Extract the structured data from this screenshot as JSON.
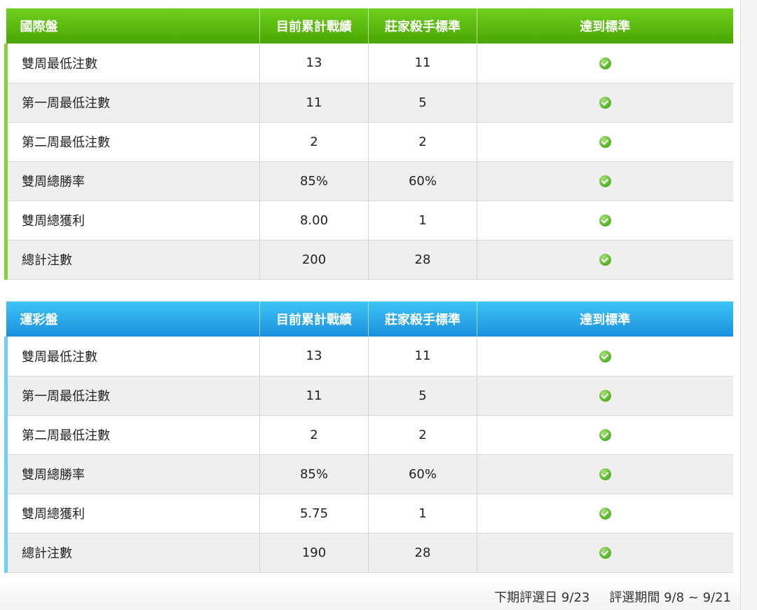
{
  "tables": [
    {
      "title": "國際盤",
      "headers": [
        "目前累計戰績",
        "莊家殺手標準",
        "達到標準"
      ],
      "rows": [
        {
          "label": "雙周最低注數",
          "current": "13",
          "standard": "11",
          "achieved": "check-icon"
        },
        {
          "label": "第一周最低注數",
          "current": "11",
          "standard": "5",
          "achieved": "check-icon"
        },
        {
          "label": "第二周最低注數",
          "current": "2",
          "standard": "2",
          "achieved": "check-icon"
        },
        {
          "label": "雙周總勝率",
          "current": "85%",
          "standard": "60%",
          "achieved": "check-icon"
        },
        {
          "label": "雙周總獲利",
          "current": "8.00",
          "standard": "1",
          "achieved": "check-icon"
        },
        {
          "label": "總計注數",
          "current": "200",
          "standard": "28",
          "achieved": "check-icon"
        }
      ],
      "colors": {
        "header_top": "#6fd020",
        "header_bottom": "#4aa600",
        "accent": "#84d33a"
      }
    },
    {
      "title": "運彩盤",
      "headers": [
        "目前累計戰績",
        "莊家殺手標準",
        "達到標準"
      ],
      "rows": [
        {
          "label": "雙周最低注數",
          "current": "13",
          "standard": "11",
          "achieved": "check-icon"
        },
        {
          "label": "第一周最低注數",
          "current": "11",
          "standard": "5",
          "achieved": "check-icon"
        },
        {
          "label": "第二周最低注數",
          "current": "2",
          "standard": "2",
          "achieved": "check-icon"
        },
        {
          "label": "雙周總勝率",
          "current": "85%",
          "standard": "60%",
          "achieved": "check-icon"
        },
        {
          "label": "雙周總獲利",
          "current": "5.75",
          "standard": "1",
          "achieved": "check-icon"
        },
        {
          "label": "總計注數",
          "current": "190",
          "standard": "28",
          "achieved": "check-icon"
        }
      ],
      "colors": {
        "header_top": "#3ec4f7",
        "header_bottom": "#1a8fdd",
        "accent": "#6fd0ef"
      }
    }
  ],
  "footer": {
    "next_selection": "下期評選日 9/23",
    "selection_period": "評選期間 9/8 ~ 9/21"
  }
}
